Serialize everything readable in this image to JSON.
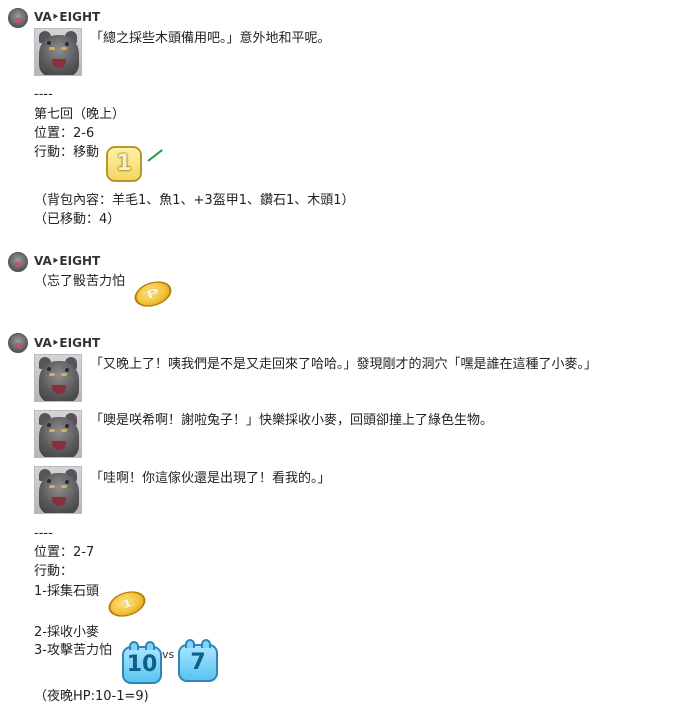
{
  "posts": [
    {
      "user": "VA‣EIGHT",
      "lines": [
        "「總之採些木頭備用吧。」意外地和平呢。",
        "----",
        "第七回（晚上）",
        "位置：2-6",
        "行動：移動",
        "（背包內容：羊毛1、魚1、+3盔甲1、鑽石1、木頭1）",
        "（已移動：4）"
      ],
      "dice": [
        {
          "kind": "yellow",
          "value": "1"
        }
      ]
    },
    {
      "user": "VA‣EIGHT",
      "lines": [
        "（忘了骰苦力怕"
      ],
      "dice": [
        {
          "kind": "coin",
          "value": "P"
        }
      ]
    },
    {
      "user": "VA‣EIGHT",
      "lines": [
        "「又晚上了！咦我們是不是又走回來了哈哈。」發現剛才的洞穴「嘿是誰在這種了小麥。」",
        "「噢是咲希啊！謝啦兔子！」快樂採收小麥，回頭卻撞上了綠色生物。",
        "「哇啊！你這傢伙還是出現了！看我的。」",
        "----",
        "位置：2-7",
        "行動：",
        "1-採集石頭",
        "2-採收小麥",
        "3-攻擊苦力怕",
        "（夜晚HP:10-1=9)"
      ],
      "dice": [
        {
          "kind": "coin",
          "value": "1"
        },
        {
          "kind": "blue",
          "value": "10"
        },
        {
          "kind": "blue",
          "value": "7"
        }
      ],
      "vs_label": "vs"
    }
  ]
}
